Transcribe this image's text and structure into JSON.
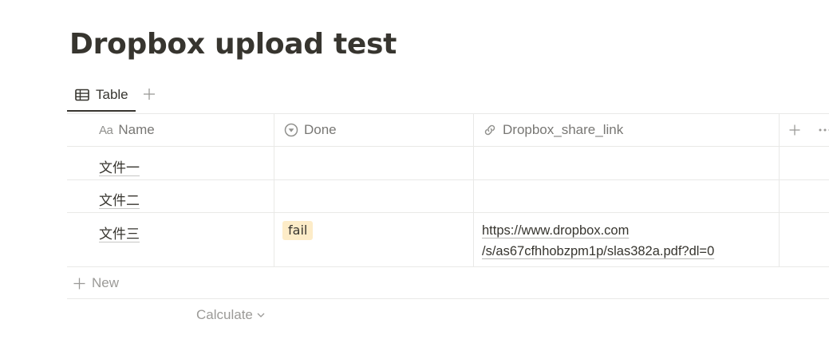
{
  "page": {
    "title": "Dropbox upload test"
  },
  "views": {
    "tabs": [
      {
        "label": "Table",
        "icon": "table-icon"
      }
    ],
    "add_view_icon": "plus-icon"
  },
  "table": {
    "columns": [
      {
        "label": "Name",
        "icon": "Aa",
        "icon_name": "text-property-icon"
      },
      {
        "label": "Done",
        "icon_name": "status-property-icon"
      },
      {
        "label": "Dropbox_share_link",
        "icon_name": "link-icon"
      }
    ],
    "add_column_icon": "plus-icon",
    "more_icon": "ellipsis-icon",
    "rows": [
      {
        "name": "文件一",
        "done": "",
        "link": ""
      },
      {
        "name": "文件二",
        "done": "",
        "link": ""
      },
      {
        "name": "文件三",
        "done": "fail",
        "link_lines": [
          "https://www.dropbox.com",
          "/s/as67cfhhobzpm1p/slas382a.pdf?dl=0"
        ]
      }
    ],
    "tag_color": "#fdecc8",
    "new_row_label": "New",
    "calculate_label": "Calculate"
  }
}
